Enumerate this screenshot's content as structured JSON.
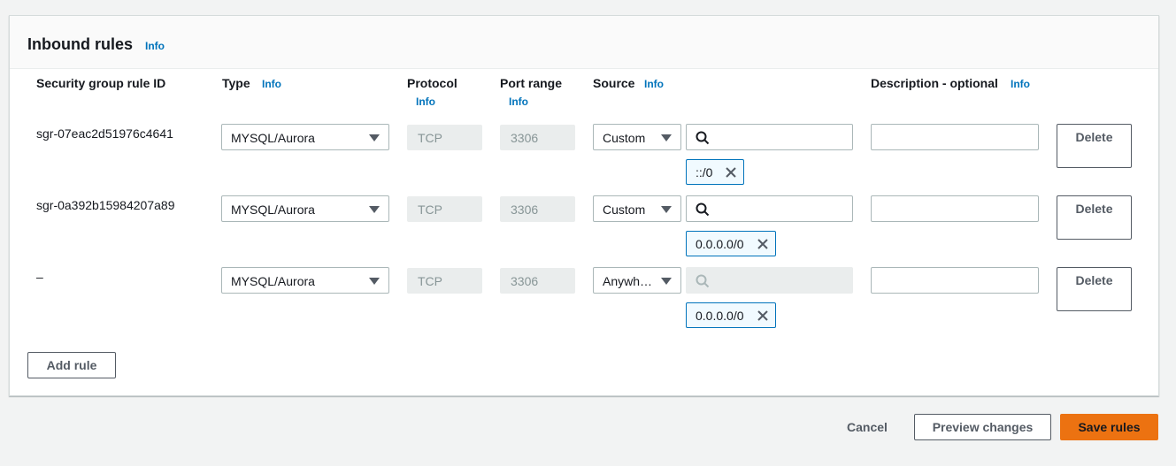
{
  "panel": {
    "title": "Inbound rules",
    "info": "Info"
  },
  "columns": {
    "rule_id": "Security group rule ID",
    "type": "Type",
    "protocol": "Protocol",
    "port_range": "Port range",
    "source": "Source",
    "description": "Description - optional",
    "info": "Info"
  },
  "rows": [
    {
      "rule_id": "sgr-07eac2d51976c4641",
      "type": "MYSQL/Aurora",
      "protocol": "TCP",
      "port": "3306",
      "source_type": "Custom",
      "search_value": "",
      "token": "::/0",
      "description": "",
      "delete": "Delete"
    },
    {
      "rule_id": "sgr-0a392b15984207a89",
      "type": "MYSQL/Aurora",
      "protocol": "TCP",
      "port": "3306",
      "source_type": "Custom",
      "search_value": "",
      "token": "0.0.0.0/0",
      "description": "",
      "delete": "Delete"
    },
    {
      "rule_id": "–",
      "type": "MYSQL/Aurora",
      "protocol": "TCP",
      "port": "3306",
      "source_type": "Anywh…",
      "search_value": "",
      "token": "0.0.0.0/0",
      "description": "",
      "delete": "Delete"
    }
  ],
  "add_rule": "Add rule",
  "footer": {
    "cancel": "Cancel",
    "preview": "Preview changes",
    "save": "Save rules"
  },
  "colors": {
    "accent": "#ec7211",
    "link": "#0073bb"
  },
  "icons": {
    "search": "search-icon",
    "remove": "close-icon",
    "dropdown": "caret-down-icon"
  }
}
